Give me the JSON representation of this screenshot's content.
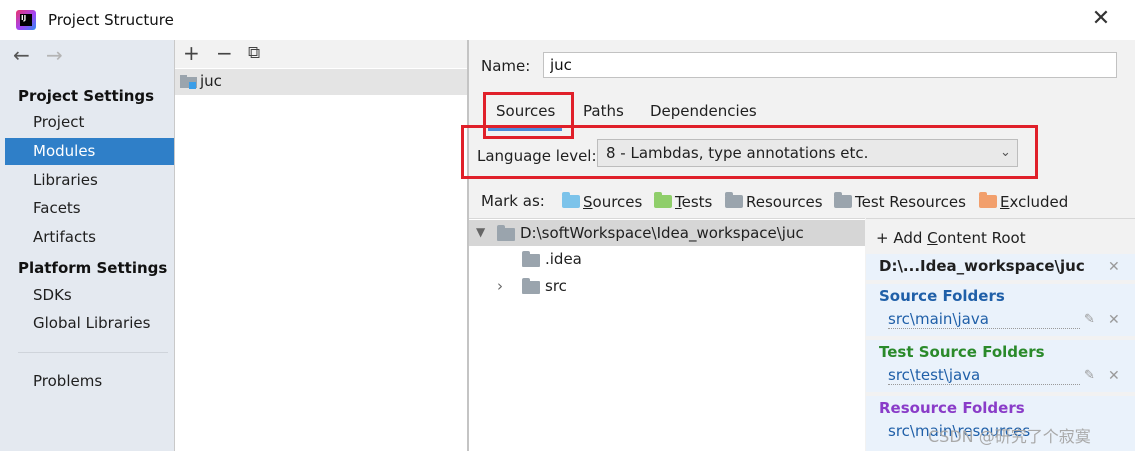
{
  "window": {
    "title": "Project Structure",
    "close_glyph": "✕"
  },
  "nav": {
    "back": "←",
    "forward": "→"
  },
  "sidebar": {
    "project_settings_title": "Project Settings",
    "project_settings_items": [
      "Project",
      "Modules",
      "Libraries",
      "Facets",
      "Artifacts"
    ],
    "selected": "Modules",
    "platform_settings_title": "Platform Settings",
    "platform_settings_items": [
      "SDKs",
      "Global Libraries"
    ],
    "problems": "Problems"
  },
  "modules_toolbar": {
    "add": "+",
    "remove": "−",
    "copy": "⧉"
  },
  "modules": [
    {
      "name": "juc"
    }
  ],
  "detail": {
    "name_label": "Name:",
    "name_value": "juc",
    "tabs": [
      "Sources",
      "Paths",
      "Dependencies"
    ],
    "active_tab": "Sources",
    "language_level_label": "Language level:",
    "language_level_value": "8 - Lambdas, type annotations etc.",
    "mark_as_label": "Mark as:",
    "mark_as": [
      {
        "label": "Sources",
        "mnemonic": "S",
        "rest": "ources",
        "color": "#7cc3ea"
      },
      {
        "label": "Tests",
        "mnemonic": "T",
        "rest": "ests",
        "color": "#8fce6a"
      },
      {
        "label": "Resources",
        "mnemonic": "",
        "rest": "Resources",
        "color": "#9aa4ad"
      },
      {
        "label": "Test Resources",
        "mnemonic": "",
        "rest": "Test Resources",
        "color": "#9aa4ad"
      },
      {
        "label": "Excluded",
        "mnemonic": "E",
        "rest": "xcluded",
        "color": "#f29f6c"
      }
    ]
  },
  "tree": {
    "root": "D:\\softWorkspace\\Idea_workspace\\juc",
    "children": [
      {
        "name": ".idea",
        "expandable": false
      },
      {
        "name": "src",
        "expandable": true
      }
    ]
  },
  "content_roots": {
    "add_label_pre": "Add ",
    "add_label_mnemonic": "C",
    "add_label_post": "ontent Root",
    "root_path": "D:\\...Idea_workspace\\juc",
    "groups": [
      {
        "title": "Source Folders",
        "path": "src\\main\\java",
        "color": "#1f5fa8"
      },
      {
        "title": "Test Source Folders",
        "path": "src\\test\\java",
        "color": "#2a8a2a"
      },
      {
        "title": "Resource Folders",
        "path": "src\\main\\resources",
        "color": "#8a3cc8"
      }
    ]
  },
  "watermark": "CSDN @研究了个寂寞",
  "colors": {
    "selection": "#2f7fc8",
    "highlight_box": "#e0202a",
    "tab_underline": "#4a8ad8"
  }
}
